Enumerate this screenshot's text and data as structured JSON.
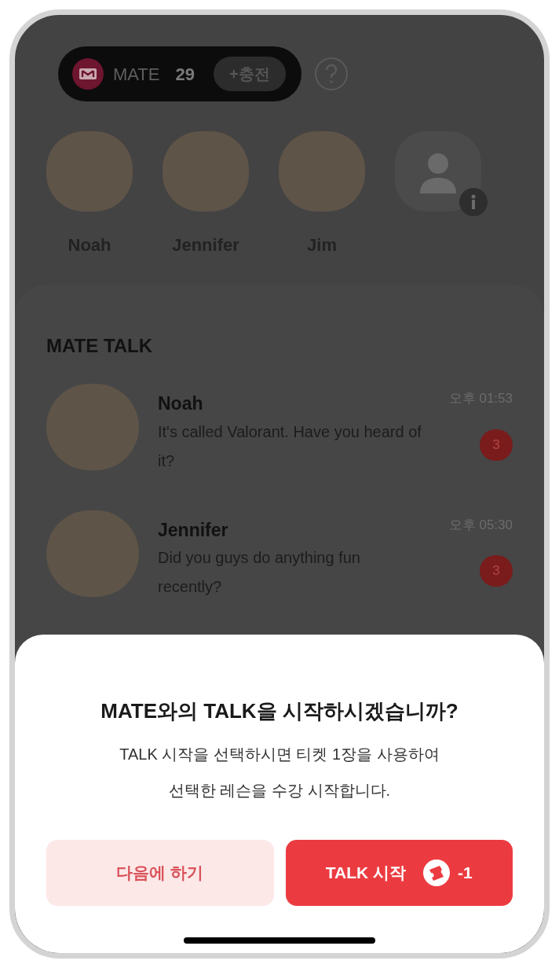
{
  "wallet": {
    "label": "MATE",
    "count": "29",
    "charge": "+충전"
  },
  "mates": [
    {
      "name": "Noah",
      "kind": "photo"
    },
    {
      "name": "Jennifer",
      "kind": "photo"
    },
    {
      "name": "Jim",
      "kind": "photo"
    },
    {
      "kind": "empty"
    }
  ],
  "section_title": "MATE TALK",
  "chats": [
    {
      "name": "Noah",
      "message": "It's called Valorant. Have you heard of it?",
      "time": "오후 01:53",
      "unread": "3"
    },
    {
      "name": "Jennifer",
      "message": "Did you guys do anything fun recently?",
      "time": "오후 05:30",
      "unread": "3"
    }
  ],
  "dialog": {
    "title": "MATE와의 TALK을 시작하시겠습니까?",
    "body": [
      "TALK 시작을 선택하시면 티켓 1장을 사용하여",
      "선택한 레슨을 수강 시작합니다."
    ],
    "cancel": "다음에 하기",
    "confirm": "TALK 시작",
    "cost": "-1"
  }
}
